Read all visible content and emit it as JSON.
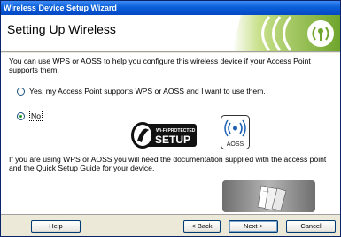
{
  "window": {
    "title": "Wireless Device Setup Wizard"
  },
  "header": {
    "title": "Setting Up Wireless"
  },
  "content": {
    "intro": "You can use WPS or AOSS to help you configure this wireless device if your Access Point supports them.",
    "options": [
      {
        "label": "Yes, my Access Point supports WPS or AOSS and I want to use them.",
        "selected": false
      },
      {
        "label": "No",
        "selected": true
      }
    ],
    "wps_logo_text_top": "Wi-Fi PROTECTED",
    "wps_logo_text_main": "SETUP",
    "aoss_logo_text": "AOSS",
    "note": "If you are using WPS or AOSS you will need the documentation supplied with the access point and the Quick Setup Guide for your device."
  },
  "footer": {
    "help": "Help",
    "back": "< Back",
    "next": "Next >",
    "cancel": "Cancel"
  },
  "colors": {
    "titlebar": "#0a5fd8",
    "banner_green": "#7fb23a",
    "radio_selected": "#2c9a2c"
  }
}
